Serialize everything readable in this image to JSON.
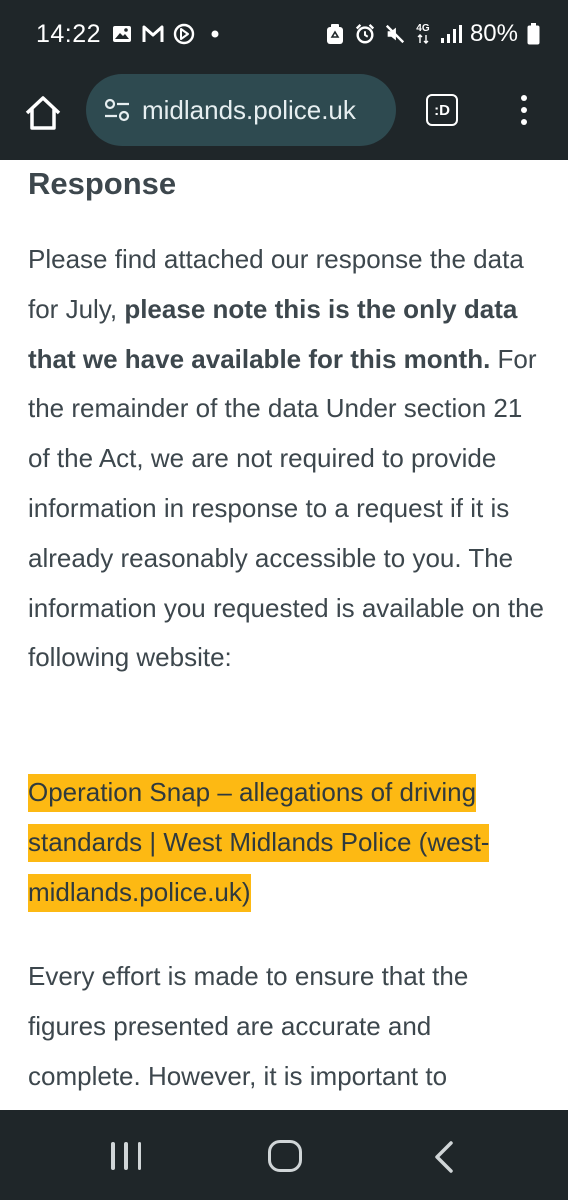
{
  "status_bar": {
    "time": "14:22",
    "left_icons": [
      "gallery-icon",
      "gmail-icon",
      "app-circle-icon",
      "dot-icon"
    ],
    "right_icons": [
      "recycle-badge-icon",
      "alarm-icon",
      "mute-icon",
      "network-4g-icon",
      "signal-icon",
      "battery-icon"
    ],
    "network_type": "4G",
    "battery_percent": "80%"
  },
  "browser": {
    "url": "midlands.police.uk",
    "tabs_label": ":D"
  },
  "content": {
    "heading": "Response",
    "paragraph1": {
      "text_a": "Please find attached our response the data for July, ",
      "bold": "please note this is the only data that we have available for this month.",
      "text_b": "  For the remainder of the data Under section 21 of the Act, we are not required to provide information in response to a request if it is already reasonably accessible to you. The information you requested is available on the following website:"
    },
    "link_text": "Operation Snap – allegations of driving standards | West Midlands Police (west-midlands.police.uk)",
    "paragraph3": "Every effort is made to ensure that the figures presented are accurate and complete. However, it is important to"
  },
  "colors": {
    "system_bar": "#1f2629",
    "url_pill": "#2e4a50",
    "body_text": "#3d474d",
    "link_highlight": "#fdb913"
  }
}
